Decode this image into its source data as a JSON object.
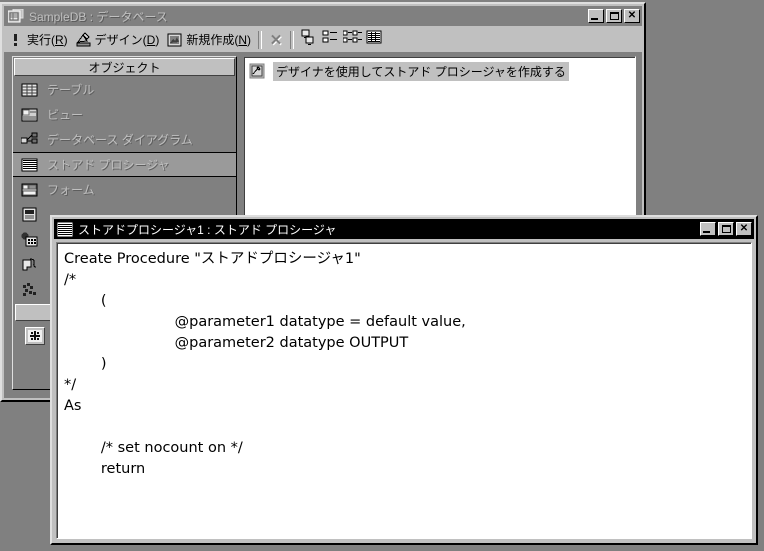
{
  "desktop": {
    "background_color": "#808080"
  },
  "outer_window": {
    "title": "SampleDB : データベース",
    "title_icon": "database-window-icon",
    "active": false,
    "titlebar_color": "#808080",
    "buttons": {
      "minimize_label": "_",
      "maximize_label": "□",
      "close_label": "✕"
    },
    "toolbar": {
      "run": {
        "label_pre": "実行(",
        "label_key": "R",
        "label_post": ")",
        "icon": "run-exclamation-icon"
      },
      "design": {
        "label_pre": "デザイン(",
        "label_key": "D",
        "label_post": ")",
        "icon": "design-icon"
      },
      "new": {
        "label_pre": "新規作成(",
        "label_key": "N",
        "label_post": ")",
        "icon": "new-object-icon"
      },
      "delete": {
        "label": "✕",
        "icon": "delete-x-icon",
        "enabled": false
      },
      "view_large_icons": {
        "icon": "large-icons-view-icon"
      },
      "view_small_icons": {
        "icon": "small-icons-view-icon"
      },
      "view_list": {
        "icon": "list-view-icon"
      },
      "view_details": {
        "icon": "details-view-icon"
      }
    }
  },
  "sidebar": {
    "header": "オブジェクト",
    "items": [
      {
        "label": "テーブル",
        "icon": "table-icon",
        "selected": false
      },
      {
        "label": "ビュー",
        "icon": "view-icon",
        "selected": false
      },
      {
        "label": "データベース ダイアグラム",
        "icon": "database-diagram-icon",
        "selected": false
      },
      {
        "label": "ストアド プロシージャ",
        "icon": "stored-procedure-icon",
        "selected": true
      },
      {
        "label": "フォーム",
        "icon": "form-icon",
        "selected": false
      },
      {
        "label": "",
        "icon": "report-icon",
        "selected": false
      },
      {
        "label": "",
        "icon": "page-icon",
        "selected": false
      },
      {
        "label": "",
        "icon": "macro-icon",
        "selected": false
      },
      {
        "label": "",
        "icon": "module-icon",
        "selected": false
      }
    ],
    "group_blank_label": "",
    "favorites_icon": "favorites-icon"
  },
  "list_pane": {
    "rows": [
      {
        "label": "デザイナを使用してストアド プロシージャを作成する",
        "icon": "create-with-designer-icon",
        "selected": true
      }
    ]
  },
  "inner_window": {
    "title": "ストアドプロシージャ1 : ストアド プロシージャ",
    "title_icon": "stored-procedure-icon",
    "active": true,
    "titlebar_color": "#000000",
    "buttons": {
      "minimize_label": "_",
      "maximize_label": "□",
      "close_label": "✕"
    },
    "code": "Create Procedure \"ストアドプロシージャ1\"\n/*\n\t(\n\t\t\t@parameter1 datatype = default value,\n\t\t\t@parameter2 datatype OUTPUT\n\t)\n*/\nAs\n\n\t/* set nocount on */\n\treturn"
  }
}
